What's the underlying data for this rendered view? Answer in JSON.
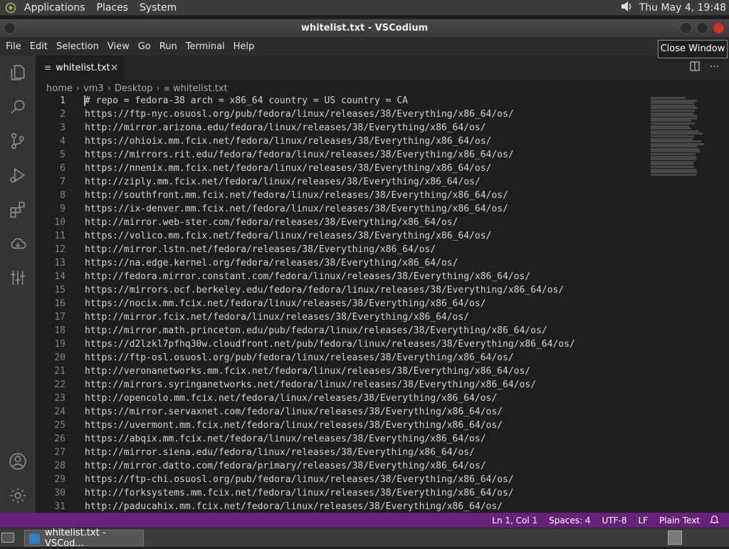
{
  "top_panel": {
    "menus": [
      "Applications",
      "Places",
      "System"
    ],
    "clock": "Thu May  4, 19:48",
    "volume_icon": "volume-icon"
  },
  "window": {
    "title": "whitelist.txt - VSCodium",
    "close_tooltip": "Close Window"
  },
  "menubar": [
    "File",
    "Edit",
    "Selection",
    "View",
    "Go",
    "Run",
    "Terminal",
    "Help"
  ],
  "activity_bar": [
    "explorer-icon",
    "search-icon",
    "source-control-icon",
    "run-debug-icon",
    "extensions-icon",
    "remote-icon",
    "settings-sliders-icon",
    "account-icon",
    "manage-gear-icon"
  ],
  "tab": {
    "label": "whitelist.txt",
    "close": "×"
  },
  "breadcrumb": [
    "home",
    "vm3",
    "Desktop",
    "whitelist.txt"
  ],
  "editor": {
    "lines": [
      "# repo = fedora-38 arch = x86_64 country = US country = CA",
      "https://ftp-nyc.osuosl.org/pub/fedora/linux/releases/38/Everything/x86_64/os/",
      "http://mirror.arizona.edu/fedora/linux/releases/38/Everything/x86_64/os/",
      "https://ohioix.mm.fcix.net/fedora/linux/releases/38/Everything/x86_64/os/",
      "https://mirrors.rit.edu/fedora/fedora/linux/releases/38/Everything/x86_64/os/",
      "https://nnenix.mm.fcix.net/fedora/linux/releases/38/Everything/x86_64/os/",
      "http://ziply.mm.fcix.net/fedora/linux/releases/38/Everything/x86_64/os/",
      "http://southfront.mm.fcix.net/fedora/linux/releases/38/Everything/x86_64/os/",
      "https://ix-denver.mm.fcix.net/fedora/linux/releases/38/Everything/x86_64/os/",
      "http://mirror.web-ster.com/fedora/releases/38/Everything/x86_64/os/",
      "https://volico.mm.fcix.net/fedora/linux/releases/38/Everything/x86_64/os/",
      "http://mirror.lstn.net/fedora/releases/38/Everything/x86_64/os/",
      "https://na.edge.kernel.org/fedora/releases/38/Everything/x86_64/os/",
      "http://fedora.mirror.constant.com/fedora/linux/releases/38/Everything/x86_64/os/",
      "https://mirrors.ocf.berkeley.edu/fedora/fedora/linux/releases/38/Everything/x86_64/os/",
      "https://nocix.mm.fcix.net/fedora/linux/releases/38/Everything/x86_64/os/",
      "http://mirror.fcix.net/fedora/linux/releases/38/Everything/x86_64/os/",
      "http://mirror.math.princeton.edu/pub/fedora/linux/releases/38/Everything/x86_64/os/",
      "https://d2lzkl7pfhq30w.cloudfront.net/pub/fedora/linux/releases/38/Everything/x86_64/os/",
      "https://ftp-osl.osuosl.org/pub/fedora/linux/releases/38/Everything/x86_64/os/",
      "http://veronanetworks.mm.fcix.net/fedora/linux/releases/38/Everything/x86_64/os/",
      "http://mirrors.syringanetworks.net/fedora/linux/releases/38/Everything/x86_64/os/",
      "http://opencolo.mm.fcix.net/fedora/linux/releases/38/Everything/x86_64/os/",
      "https://mirror.servaxnet.com/fedora/linux/releases/38/Everything/x86_64/os/",
      "https://uvermont.mm.fcix.net/fedora/linux/releases/38/Everything/x86_64/os/",
      "https://abqix.mm.fcix.net/fedora/linux/releases/38/Everything/x86_64/os/",
      "http://mirror.siena.edu/fedora/linux/releases/38/Everything/x86_64/os/",
      "http://mirror.datto.com/fedora/primary/releases/38/Everything/x86_64/os/",
      "https://ftp-chi.osuosl.org/pub/fedora/linux/releases/38/Everything/x86_64/os/",
      "http://forksystems.mm.fcix.net/fedora/linux/releases/38/Everything/x86_64/os/",
      "http://paducahix.mm.fcix.net/fedora/linux/releases/38/Everything/x86_64/os/"
    ]
  },
  "status_bar": {
    "position": "Ln 1, Col 1",
    "spaces": "Spaces: 4",
    "encoding": "UTF-8",
    "eol": "LF",
    "language": "Plain Text",
    "accent": "#68217a"
  },
  "taskbar": {
    "item_label": "whitelist.txt - VSCod..."
  }
}
